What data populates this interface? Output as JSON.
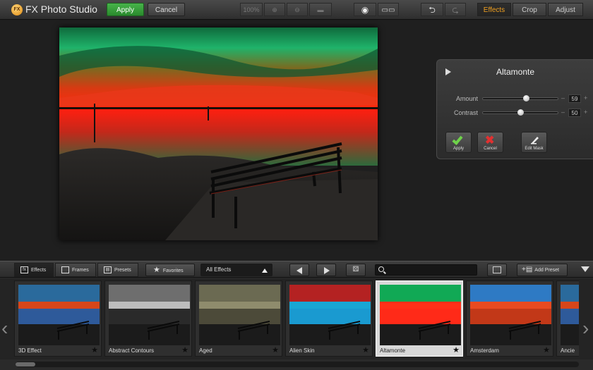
{
  "app": {
    "title": "FX Photo Studio",
    "logo_text": "FX"
  },
  "toolbar": {
    "apply_label": "Apply",
    "cancel_label": "Cancel",
    "zoom_label": "100%",
    "tabs": [
      "Effects",
      "Crop",
      "Adjust"
    ],
    "active_tab": "Effects"
  },
  "panel": {
    "title": "Altamonte",
    "sliders": [
      {
        "label": "Amount",
        "value": 59
      },
      {
        "label": "Contrast",
        "value": 50
      }
    ],
    "buttons": {
      "apply": "Apply",
      "cancel": "Cancel",
      "edit_mask": "Edit Mask"
    }
  },
  "bottom": {
    "tabs": [
      "Effects",
      "Frames",
      "Presets"
    ],
    "favorites_label": "Favorites",
    "filter_label": "All Effects",
    "search_placeholder": "",
    "add_preset_label": "Add Preset"
  },
  "thumbnails": [
    {
      "name": "3D Effect",
      "selected": false
    },
    {
      "name": "Abstract Contours",
      "selected": false
    },
    {
      "name": "Aged",
      "selected": false
    },
    {
      "name": "Alien Skin",
      "selected": false
    },
    {
      "name": "Altamonte",
      "selected": true
    },
    {
      "name": "Amsterdam",
      "selected": false
    },
    {
      "name": "Ancie",
      "selected": false
    }
  ]
}
